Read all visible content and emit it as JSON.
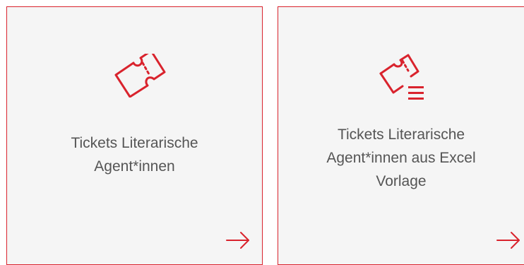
{
  "cards": [
    {
      "title_lines": [
        "Tickets Literarische",
        "Agent*innen"
      ],
      "icon": "ticket-icon",
      "arrow_icon": "arrow-right-icon"
    },
    {
      "title_lines": [
        "Tickets Literarische",
        "Agent*innen aus Excel",
        "Vorlage"
      ],
      "icon": "ticket-list-icon",
      "arrow_icon": "arrow-right-icon"
    }
  ],
  "colors": {
    "accent": "#d9232d",
    "card_background": "#f5f5f5",
    "text": "#555555"
  }
}
